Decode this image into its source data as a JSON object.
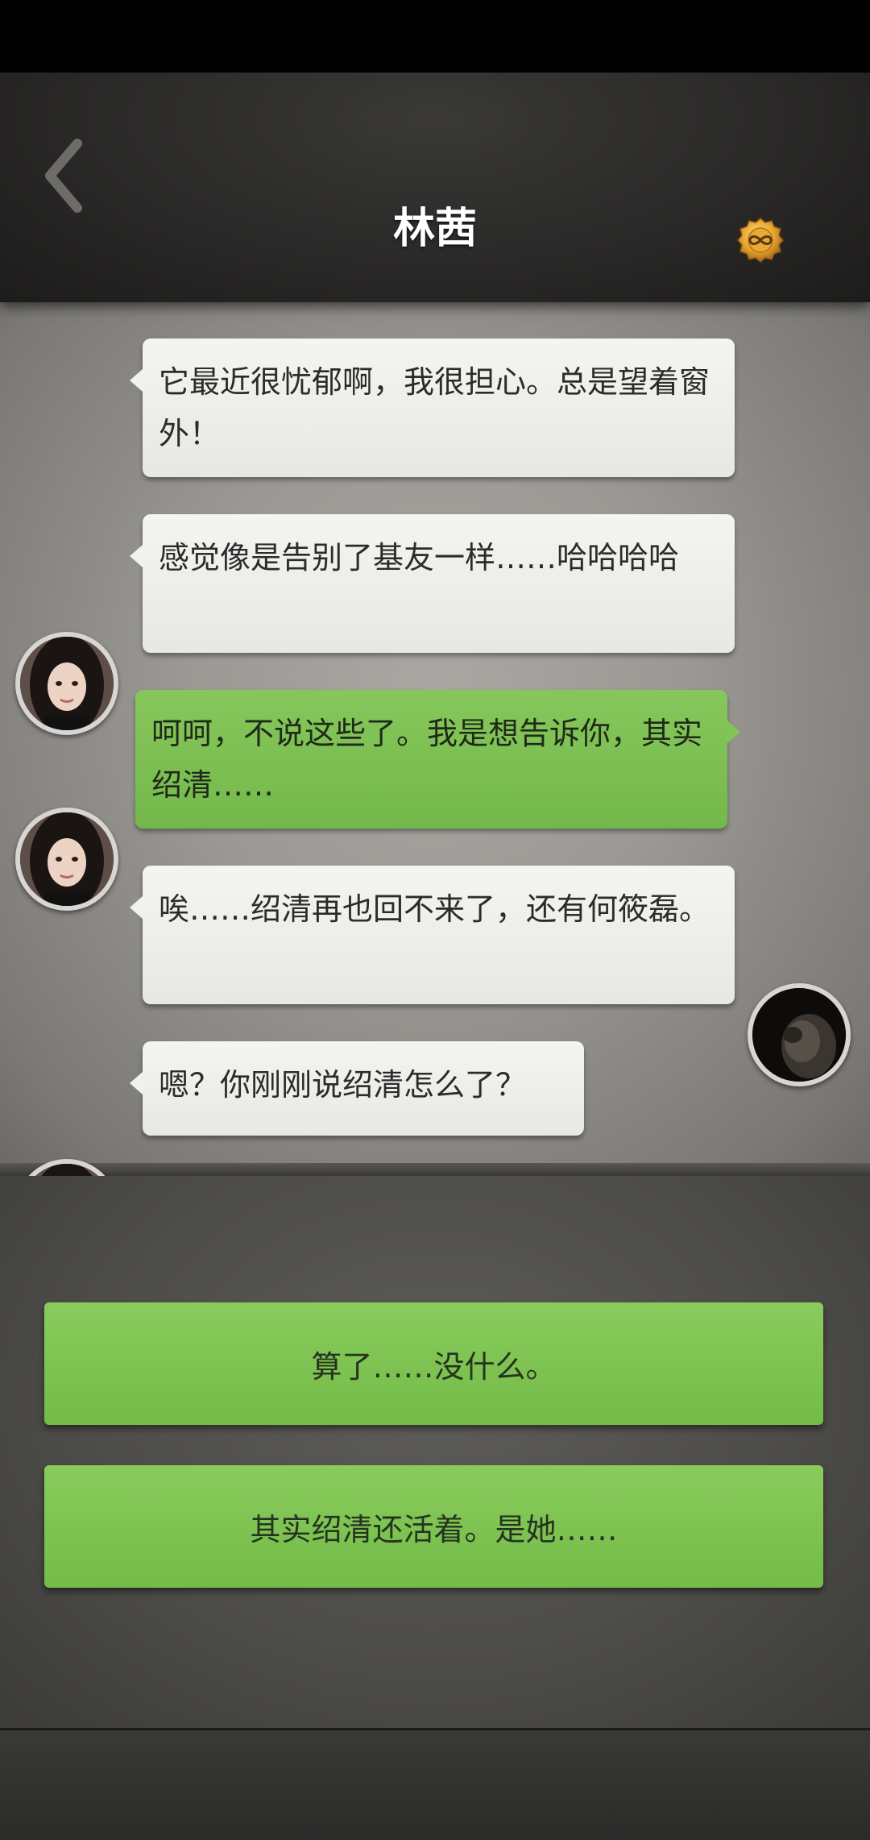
{
  "header": {
    "title": "林茜",
    "back_icon": "chevron-left-icon",
    "coin_icon": "infinity-coin-icon",
    "colors": {
      "header_bg": "#2a2928",
      "title_text": "#ffffff"
    }
  },
  "messages": [
    {
      "sender": "contact",
      "text": "它最近很忧郁啊，我很担心。总是望着窗外！"
    },
    {
      "sender": "contact",
      "text": "感觉像是告别了基友一样……哈哈哈哈"
    },
    {
      "sender": "player",
      "text": "呵呵，不说这些了。我是想告诉你，其实绍清……"
    },
    {
      "sender": "contact",
      "text": "唉……绍清再也回不来了，还有何筱磊。"
    },
    {
      "sender": "contact",
      "text": "嗯？你刚刚说绍清怎么了？"
    }
  ],
  "options": [
    {
      "label": "算了……没什么。"
    },
    {
      "label": "其实绍清还活着。是她……"
    }
  ],
  "colors": {
    "contact_bubble": "#f1f1ee",
    "player_bubble": "#82c458",
    "option_button": "#80c455"
  }
}
